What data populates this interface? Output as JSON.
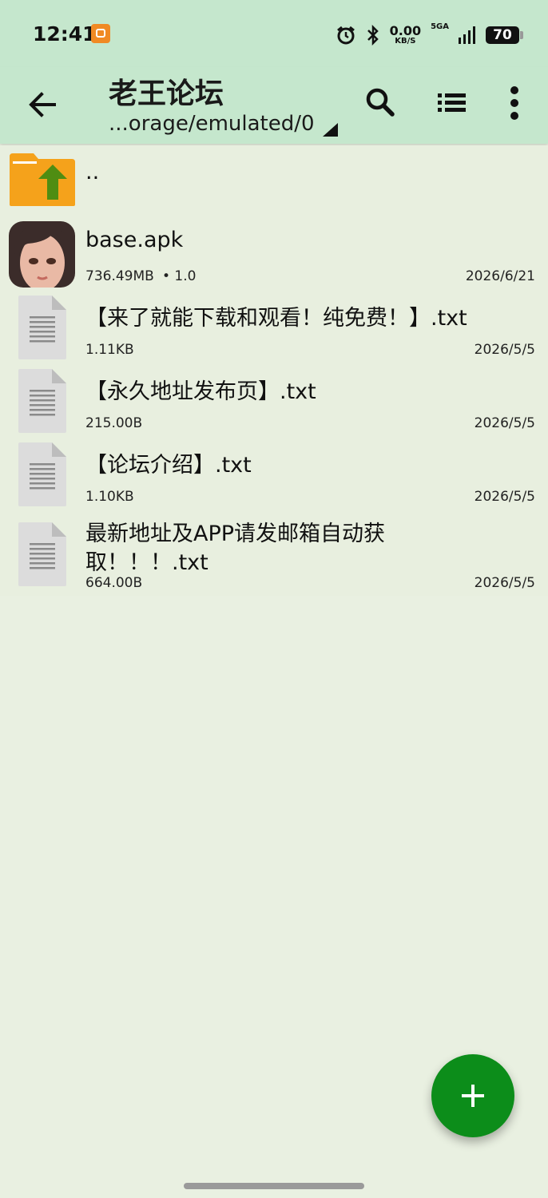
{
  "status_bar": {
    "time": "12:41",
    "net_speed": "0.00",
    "net_unit": "KB/S",
    "net_type": "5GA",
    "battery": "70",
    "icons": [
      "app-notification-icon",
      "alarm-icon",
      "bluetooth-icon",
      "signal-icon",
      "battery-icon"
    ]
  },
  "toolbar": {
    "title": "老王论坛",
    "path": "...orage/emulated/0",
    "icons": [
      "back-arrow-icon",
      "search-icon",
      "list-view-icon",
      "more-vert-icon"
    ]
  },
  "files": {
    "parent": {
      "name": ".."
    },
    "apk": {
      "name": "base.apk",
      "size": "736.49MB",
      "version": "• 1.0",
      "date": "2026/6/21"
    },
    "txt1": {
      "name": "【来了就能下载和观看！纯免费！】.txt",
      "size": "1.11KB",
      "date": "2026/5/5"
    },
    "txt2": {
      "name": "【永久地址发布页】.txt",
      "size": "215.00B",
      "date": "2026/5/5"
    },
    "txt3": {
      "name": "【论坛介绍】.txt",
      "size": "1.10KB",
      "date": "2026/5/5"
    },
    "txt4": {
      "name_line1": "最新地址及APP请发邮箱自动获",
      "name_line2": "取！！！.txt",
      "size": "664.00B",
      "date": "2026/5/5"
    }
  },
  "fab": {
    "icon": "add-icon"
  },
  "colors": {
    "header": "#c5e7cd",
    "background": "#e9f0e1",
    "fab": "#0c8d1a",
    "folder": "#f5a21b",
    "arrow": "#4f8d12"
  }
}
